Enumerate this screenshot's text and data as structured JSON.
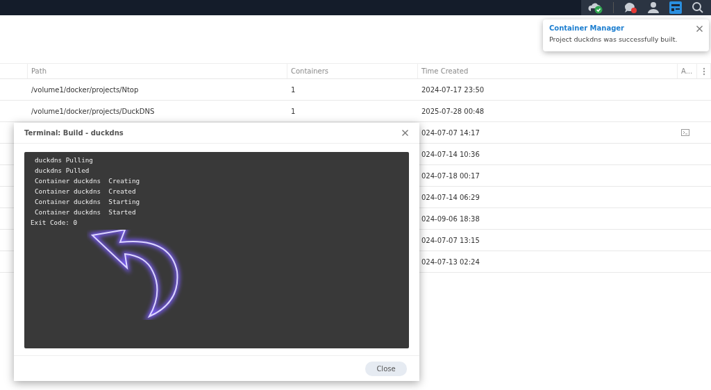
{
  "top_bar": {
    "icons": [
      {
        "kind": "cloud"
      },
      {
        "kind": "chat"
      },
      {
        "kind": "user"
      },
      {
        "kind": "widgets",
        "active": true
      },
      {
        "kind": "search"
      }
    ]
  },
  "table": {
    "columns": [
      "Path",
      "Containers",
      "Time Created",
      "A..."
    ],
    "rows": [
      {
        "path": "/volume1/docker/projects/Ntop",
        "containers": "1",
        "time": "2024-07-17 23:50",
        "terminal": false
      },
      {
        "path": "/volume1/docker/projects/DuckDNS",
        "containers": "1",
        "time": "2025-07-28 00:48",
        "terminal": false
      },
      {
        "time": "024-07-07 14:17",
        "terminal": true
      },
      {
        "time": "024-07-14 10:36",
        "terminal": false
      },
      {
        "time": "024-07-18 00:17",
        "terminal": false
      },
      {
        "time": "024-07-14 06:29",
        "terminal": false
      },
      {
        "time": "024-09-06 18:38",
        "terminal": false
      },
      {
        "time": "024-07-07 13:15",
        "terminal": false
      },
      {
        "time": "024-07-13 02:24",
        "terminal": false
      }
    ]
  },
  "notification": {
    "title": "Container Manager",
    "message": "Project duckdns was successfully built."
  },
  "dialog": {
    "title": "Terminal: Build - duckdns",
    "lines": [
      "duckdns Pulling",
      "duckdns Pulled",
      "Container duckdns  Creating",
      "Container duckdns  Created",
      "Container duckdns  Starting",
      "Container duckdns  Started",
      "Exit Code: 0"
    ],
    "button": "Close"
  }
}
